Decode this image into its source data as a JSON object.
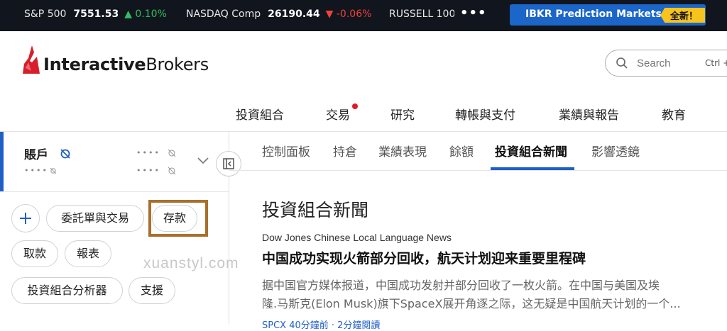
{
  "ticker": {
    "items": [
      {
        "name": "S&P 500",
        "price": "7551.53",
        "change": "▲ 0.10%",
        "direction": "up"
      },
      {
        "name": "NASDAQ Comp",
        "price": "26190.44",
        "change": "▼ -0.06%",
        "direction": "down"
      },
      {
        "name": "RUSSELL 100(",
        "price": "",
        "change": "",
        "direction": ""
      }
    ],
    "more_label": "•••",
    "promo_label": "IBKR Prediction Markets",
    "promo_badge": "全新！"
  },
  "header": {
    "logo_bold": "Interactive",
    "logo_rest": "Brokers",
    "search_placeholder": "Search",
    "search_shortcut": "Ctrl +"
  },
  "main_nav": [
    "投資組合",
    "交易",
    "研究",
    "轉帳與支付",
    "業績與報告",
    "教育"
  ],
  "account": {
    "title": "賬戶",
    "masked": "••••"
  },
  "actions": {
    "orders_trades": "委託單與交易",
    "deposit": "存款",
    "withdraw": "取款",
    "reports": "報表",
    "portfolio_analyst": "投資組合分析器",
    "support": "支援"
  },
  "watermark": "xuanstyl.com",
  "tabs": [
    "控制面板",
    "持倉",
    "業績表現",
    "餘額",
    "投資組合新聞",
    "影響透鏡"
  ],
  "active_tab": "投資組合新聞",
  "news": {
    "section_title": "投資組合新聞",
    "source": "Dow Jones Chinese Local Language News",
    "headline": "中国成功实现火箭部分回收，航天计划迎来重要里程碑",
    "body_line1": "据中国官方媒体报道，中国成功发射并部分回收了一枚火箭。在中国与美国及埃",
    "body_line2": "隆.马斯克(Elon Musk)旗下SpaceX展开角逐之际，这无疑是中国航天计划的一个...",
    "meta": "SPCX  40分鐘前  · 2分鐘閱讀"
  },
  "colors": {
    "ticker_bg": "#11151d",
    "up": "#2fbf63",
    "down": "#f0413a",
    "brand_blue": "#1f5fc7",
    "badge_yellow": "#f7c31d",
    "logo_red": "#d81e2a",
    "highlight_brown": "#a96f2c"
  }
}
